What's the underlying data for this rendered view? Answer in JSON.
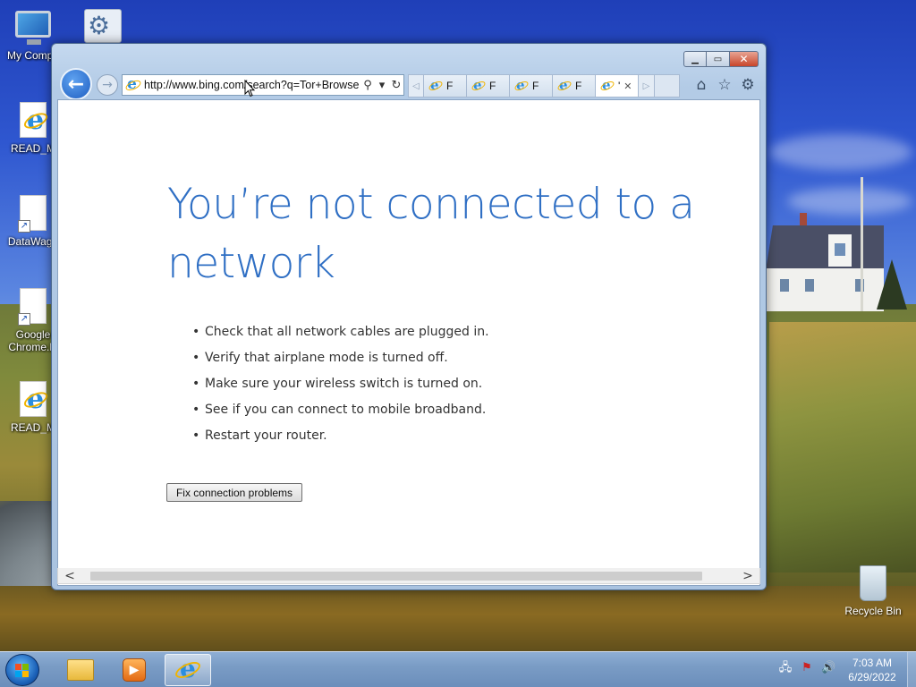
{
  "desktop": {
    "icons": [
      {
        "label": "My Computer",
        "kind": "computer"
      },
      {
        "label": "Control Panel",
        "kind": "control-panel"
      },
      {
        "label": "READ_ME",
        "kind": "ie"
      },
      {
        "label": "DataWagon",
        "kind": "doc"
      },
      {
        "label": "Google Chrome.lnk",
        "kind": "doc"
      },
      {
        "label": "READ_ME",
        "kind": "ie"
      }
    ],
    "icon_labels_visible": [
      "My Compu",
      "READ_M",
      "DataWago",
      "Google",
      "Chrome.ln",
      "READ_M"
    ],
    "recycle_bin": "Recycle Bin"
  },
  "browser": {
    "url": "http://www.bing.com/search?q=Tor+Browse",
    "tabs": [
      {
        "label": "F",
        "active": false
      },
      {
        "label": "F",
        "active": false
      },
      {
        "label": "F",
        "active": false
      },
      {
        "label": "F",
        "active": false
      },
      {
        "label": "'",
        "active": true
      }
    ],
    "page": {
      "headline": "You’re not connected to a network",
      "tips": [
        "Check that all network cables are plugged in.",
        "Verify that airplane mode is turned off.",
        "Make sure your wireless switch is turned on.",
        "See if you can connect to mobile broadband.",
        "Restart your router."
      ],
      "fix_button": "Fix connection problems"
    }
  },
  "taskbar": {
    "time": "7:03 AM",
    "date": "6/29/2022",
    "pinned": [
      "file-explorer",
      "media-player",
      "internet-explorer"
    ]
  },
  "colors": {
    "headline": "#2f6fc4",
    "taskbar": "#7a9cc5",
    "close_button": "#c8452a"
  }
}
